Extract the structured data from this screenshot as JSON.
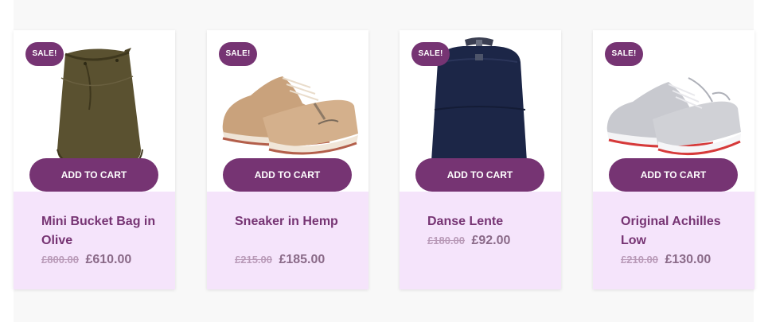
{
  "products": [
    {
      "badge": "SALE!",
      "button": "ADD TO CART",
      "name": "Mini Bucket Bag in Olive",
      "old_price": "£800.00",
      "new_price": "£610.00",
      "image_icon": "bucket-bag-icon"
    },
    {
      "badge": "SALE!",
      "button": "ADD TO CART",
      "name": "Sneaker in Hemp",
      "old_price": "£215.00",
      "new_price": "£185.00",
      "image_icon": "sneaker-icon"
    },
    {
      "badge": "SALE!",
      "button": "ADD TO CART",
      "name": "Danse Lente",
      "old_price": "£180.00",
      "new_price": "£92.00",
      "image_icon": "backpack-icon"
    },
    {
      "badge": "SALE!",
      "button": "ADD TO CART",
      "name": "Original Achilles Low",
      "old_price": "£210.00",
      "new_price": "£130.00",
      "image_icon": "sneaker-icon"
    }
  ],
  "colors": {
    "accent": "#763473",
    "info_bg": "#f5e4fb",
    "old_price": "#b99ab8",
    "new_price": "#8a6a88"
  }
}
